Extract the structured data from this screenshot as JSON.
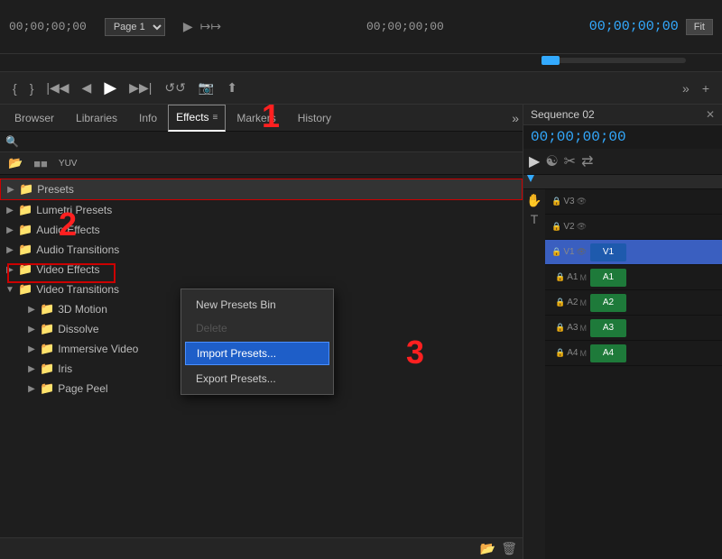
{
  "top_bar": {
    "timecode_left": "00;00;00;00",
    "page": "Page 1",
    "timecode_right": "00;00;00;00",
    "fit_label": "Fit"
  },
  "tabs": {
    "browser": "Browser",
    "libraries": "Libraries",
    "info": "Info",
    "effects": "Effects",
    "markers": "Markers",
    "history": "History"
  },
  "search": {
    "placeholder": ""
  },
  "tree": {
    "presets": "Presets",
    "lumetri_presets": "Lumetri Presets",
    "audio_effects": "Audio Effects",
    "audio_transitions": "Audio Transitions",
    "video_effects": "Video Effects",
    "video_transitions": "Video Transitions",
    "motion_3d": "3D Motion",
    "dissolve": "Dissolve",
    "immersive_video": "Immersive Video",
    "iris": "Iris",
    "page_peel": "Page Peel"
  },
  "context_menu": {
    "new_presets_bin": "New Presets Bin",
    "delete": "Delete",
    "import_presets": "Import Presets...",
    "export_presets": "Export Presets..."
  },
  "right_panel": {
    "sequence_title": "Sequence 02",
    "timecode": "00;00;00;00",
    "tracks": {
      "v3": "V3",
      "v2": "V2",
      "v1": "V1",
      "a1": "A1",
      "a2": "A2",
      "a3": "A3",
      "a4": "A4"
    }
  },
  "annotations": {
    "num1": "1",
    "num2": "2",
    "num3": "3"
  }
}
